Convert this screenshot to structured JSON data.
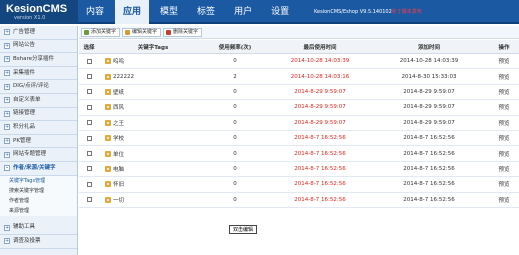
{
  "app": {
    "title": "KesionCMS",
    "version": "version X1.0",
    "top_info": "KesionCMS/Eshop V9.5.140102补丁版本发布",
    "top_info_alert": "补丁版本发布"
  },
  "nav": [
    {
      "label": "内容",
      "active": false
    },
    {
      "label": "应用",
      "active": true
    },
    {
      "label": "模型",
      "active": false
    },
    {
      "label": "标签",
      "active": false
    },
    {
      "label": "用户",
      "active": false
    },
    {
      "label": "设置",
      "active": false
    }
  ],
  "sidebar": {
    "items": [
      {
        "label": "广告管理"
      },
      {
        "label": "网站公告"
      },
      {
        "label": "Bshare分享插件"
      },
      {
        "label": "采集插件"
      },
      {
        "label": "DIG/点评/评论"
      },
      {
        "label": "自定义表单"
      },
      {
        "label": "链接管理"
      },
      {
        "label": "积分礼品"
      },
      {
        "label": "PK管理"
      },
      {
        "label": "网站专题管理"
      },
      {
        "label": "作者/来源/关键字"
      }
    ],
    "sub_items": [
      {
        "label": "关键字Tags管理"
      },
      {
        "label": "搜索关键字管理"
      },
      {
        "label": "作者管理"
      },
      {
        "label": "来源管理"
      }
    ],
    "bottom_items": [
      {
        "label": "辅助工具"
      },
      {
        "label": "调查及投票"
      }
    ]
  },
  "toolbar": {
    "add_label": "添加关键字",
    "edit_label": "编辑关键字",
    "delete_label": "删除关键字"
  },
  "table": {
    "headers": {
      "select": "选择",
      "tag": "关键字Tags",
      "freq": "使用频率(次)",
      "last_used": "最后使用时间",
      "added": "添加时间",
      "op": "操作"
    },
    "rows": [
      {
        "tag": "呜呜",
        "freq": "0",
        "last_used": "2014-10-28 14:03:39",
        "added": "2014-10-28 14:03:39",
        "op": "预览"
      },
      {
        "tag": "222222",
        "freq": "2",
        "last_used": "2014-10-28 14:03:16",
        "added": "2014-8-30 15:33:03",
        "op": "预览"
      },
      {
        "tag": "壁纸",
        "freq": "0",
        "last_used": "2014-8-29 9:59:07",
        "added": "2014-8-29 9:59:07",
        "op": "预览"
      },
      {
        "tag": "西风",
        "freq": "0",
        "last_used": "2014-8-29 9:59:07",
        "added": "2014-8-29 9:59:07",
        "op": "预览"
      },
      {
        "tag": "之王",
        "freq": "0",
        "last_used": "2014-8-29 9:59:07",
        "added": "2014-8-29 9:59:07",
        "op": "预览"
      },
      {
        "tag": "学校",
        "freq": "0",
        "last_used": "2014-8-7 16:52:56",
        "added": "2014-8-7 16:52:56",
        "op": "预览"
      },
      {
        "tag": "单位",
        "freq": "0",
        "last_used": "2014-8-7 16:52:56",
        "added": "2014-8-7 16:52:56",
        "op": "预览"
      },
      {
        "tag": "电脑",
        "freq": "0",
        "last_used": "2014-8-7 16:52:56",
        "added": "2014-8-7 16:52:56",
        "op": "预览"
      },
      {
        "tag": "怀旧",
        "freq": "0",
        "last_used": "2014-8-7 16:52:56",
        "added": "2014-8-7 16:52:56",
        "op": "预览"
      },
      {
        "tag": "一切",
        "freq": "0",
        "last_used": "2014-8-7 16:52:56",
        "added": "2014-8-7 16:52:56",
        "op": "预览"
      }
    ]
  },
  "tooltip": "双击编辑",
  "colors": {
    "header_bg": "#1b5aa3",
    "sidebar_bg": "#eaf1f9",
    "accent_red": "#e0241b"
  }
}
